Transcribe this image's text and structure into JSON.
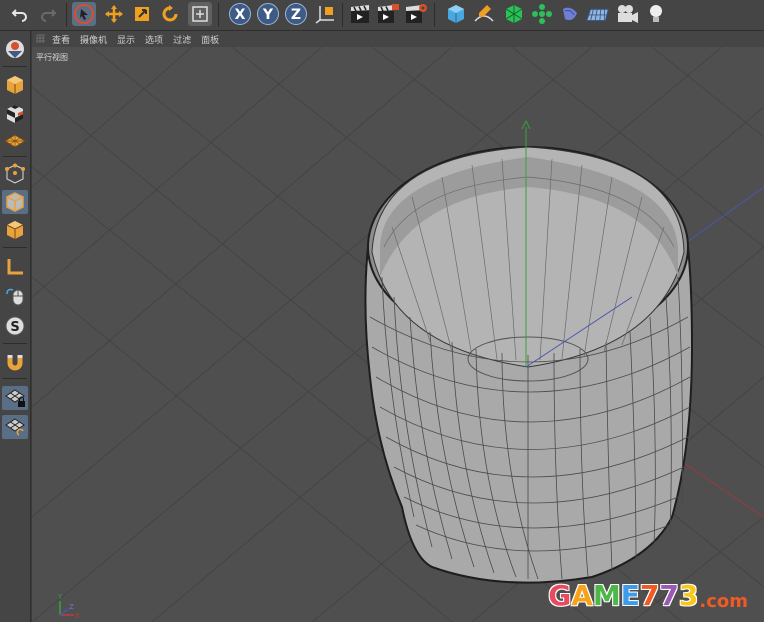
{
  "toolbar": {
    "buttons": [
      {
        "name": "undo-button",
        "icon": "undo-icon"
      },
      {
        "name": "redo-button",
        "icon": "redo-icon"
      },
      {
        "name": "live-selection-button",
        "icon": "cursor-icon"
      },
      {
        "name": "move-button",
        "icon": "move-icon"
      },
      {
        "name": "scale-button",
        "icon": "scale-icon"
      },
      {
        "name": "rotate-button",
        "icon": "rotate-icon"
      },
      {
        "name": "recent-tools-button",
        "icon": "recent-tools-icon"
      },
      {
        "name": "x-axis-button",
        "icon": "x-axis-icon",
        "label": "X"
      },
      {
        "name": "y-axis-button",
        "icon": "y-axis-icon",
        "label": "Y"
      },
      {
        "name": "z-axis-button",
        "icon": "z-axis-icon",
        "label": "Z"
      },
      {
        "name": "coordinate-system-button",
        "icon": "world-coordinates-icon"
      },
      {
        "name": "render-view-button",
        "icon": "clapboard-icon"
      },
      {
        "name": "render-to-picture-viewer-button",
        "icon": "clapboard-play-icon"
      },
      {
        "name": "render-settings-button",
        "icon": "clapboard-gear-icon"
      },
      {
        "name": "cube-button",
        "icon": "cube-icon"
      },
      {
        "name": "pen-button",
        "icon": "pen-icon"
      },
      {
        "name": "subdivision-surface-button",
        "icon": "subdivision-icon"
      },
      {
        "name": "array-button",
        "icon": "array-icon"
      },
      {
        "name": "deformer-button",
        "icon": "deformer-icon"
      },
      {
        "name": "floor-button",
        "icon": "floor-icon"
      },
      {
        "name": "camera-button",
        "icon": "camera-icon"
      },
      {
        "name": "light-button",
        "icon": "light-bulb-icon"
      }
    ]
  },
  "sidebar": {
    "items": [
      {
        "name": "make-editable-button",
        "icon": "make-editable-icon"
      },
      {
        "name": "model-mode-button",
        "icon": "model-cube-icon"
      },
      {
        "name": "texture-mode-button",
        "icon": "checker-cube-icon"
      },
      {
        "name": "workplane-button",
        "icon": "workplane-icon"
      },
      {
        "name": "points-mode-button",
        "icon": "points-cube-icon"
      },
      {
        "name": "edges-mode-button",
        "icon": "edges-cube-icon"
      },
      {
        "name": "polygons-mode-button",
        "icon": "polygons-cube-icon"
      },
      {
        "name": "axis-mode-button",
        "icon": "axis-l-icon"
      },
      {
        "name": "tweak-mode-button",
        "icon": "mouse-icon"
      },
      {
        "name": "solo-button",
        "icon": "solo-s-icon"
      },
      {
        "name": "snap-button",
        "icon": "magnet-icon"
      },
      {
        "name": "lock-workplane-button",
        "icon": "grid-lock-icon"
      },
      {
        "name": "planar-workplane-button",
        "icon": "grid-rotate-icon"
      }
    ]
  },
  "viewport": {
    "menu": [
      "查看",
      "摄像机",
      "显示",
      "选项",
      "过滤",
      "面板"
    ],
    "label": "平行视图",
    "axis_gizmo": {
      "y": "Y",
      "x": "X",
      "z": "Z"
    }
  },
  "watermark": {
    "text": "GAME773",
    "suffix": ".com",
    "colors": [
      "#e84a5f",
      "#f7a21b",
      "#4cb848",
      "#3d9be9",
      "#f15a24",
      "#9b59b6",
      "#f7c81b"
    ]
  },
  "colors": {
    "toolbar_bg": "#454545",
    "viewport_bg": "#4f4f4f",
    "selection": "#5a6e86",
    "accent_orange": "#e8a33d"
  }
}
